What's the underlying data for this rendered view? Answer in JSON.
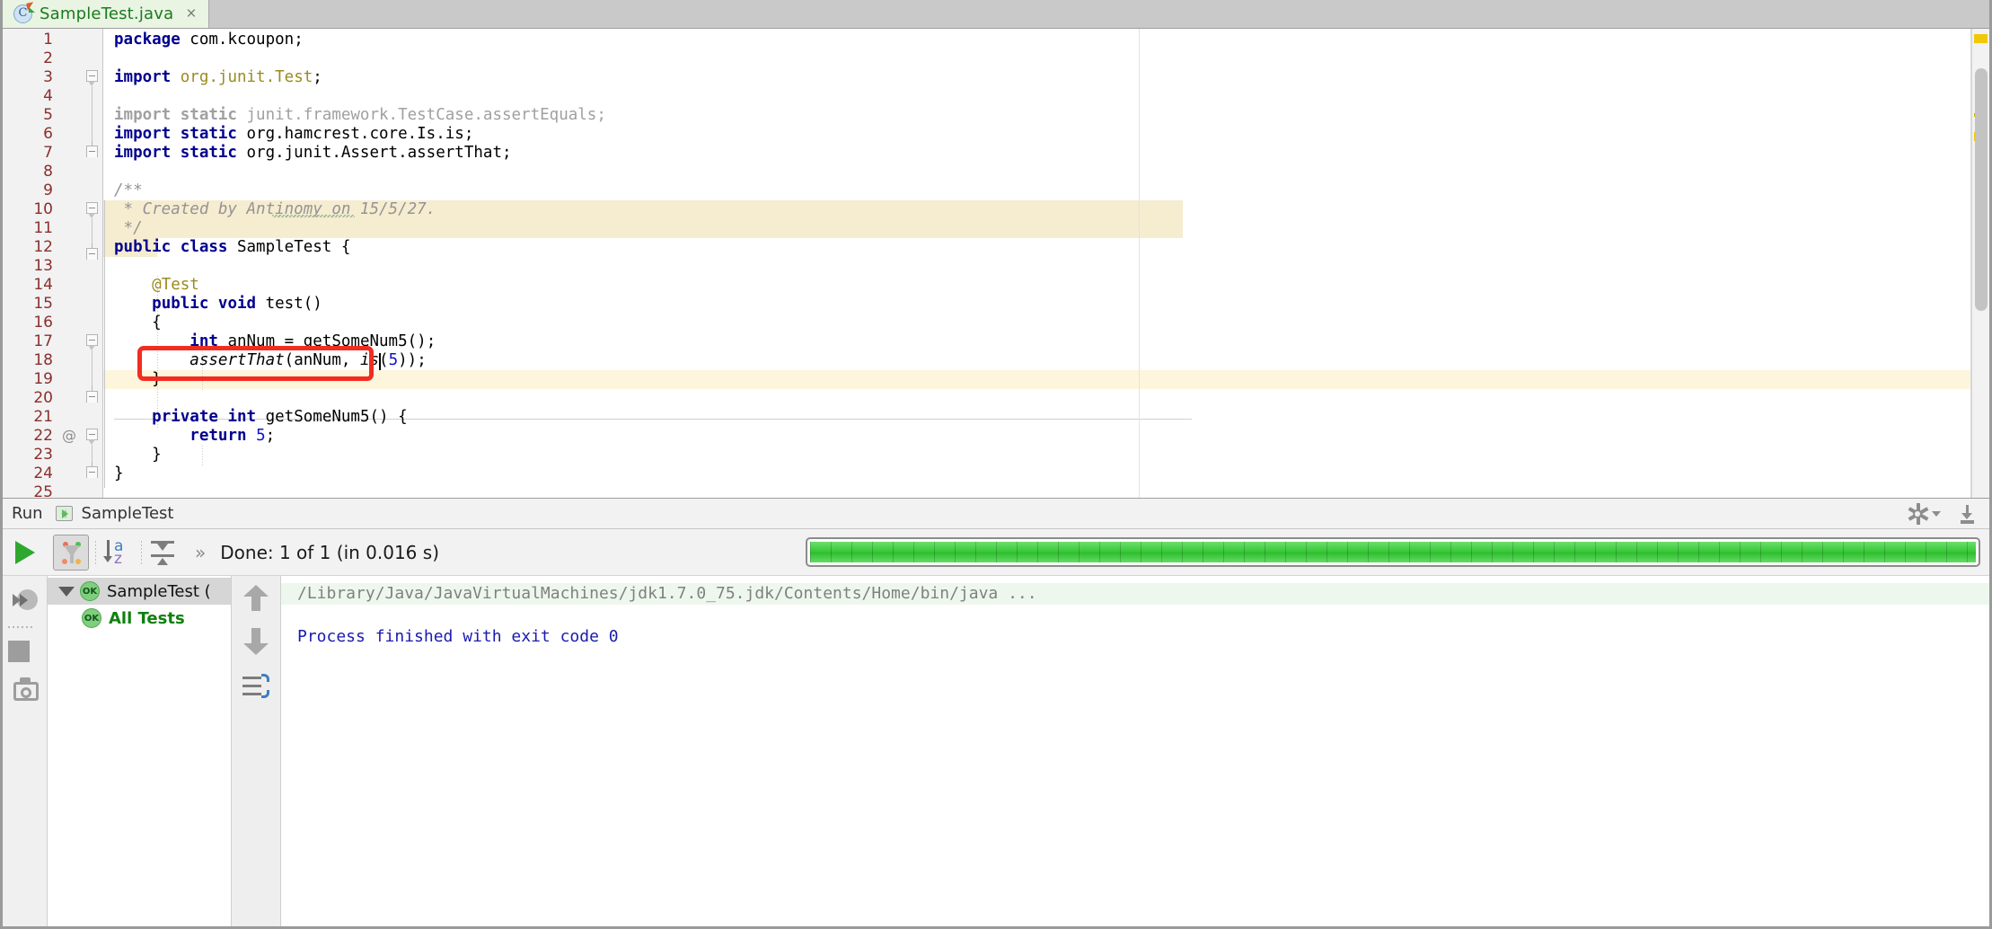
{
  "window": {
    "editor_tab": {
      "filename": "SampleTest.java",
      "icon": "java-class-icon",
      "close_label": "×"
    }
  },
  "editor": {
    "lines": [
      {
        "n": "1",
        "at": "",
        "text": "package com.kcoupon;"
      },
      {
        "n": "2",
        "at": "",
        "text": ""
      },
      {
        "n": "3",
        "at": "",
        "text": "import org.junit.Test;"
      },
      {
        "n": "4",
        "at": "",
        "text": ""
      },
      {
        "n": "5",
        "at": "",
        "text": "import static junit.framework.TestCase.assertEquals;"
      },
      {
        "n": "6",
        "at": "",
        "text": "import static org.hamcrest.core.Is.is;"
      },
      {
        "n": "7",
        "at": "",
        "text": "import static org.junit.Assert.assertThat;"
      },
      {
        "n": "8",
        "at": "",
        "text": ""
      },
      {
        "n": "9",
        "at": "",
        "text": "/**"
      },
      {
        "n": "10",
        "at": "",
        "text": " * Created by Antinomy on 15/5/27."
      },
      {
        "n": "11",
        "at": "",
        "text": " */"
      },
      {
        "n": "12",
        "at": "",
        "text": "public class SampleTest {"
      },
      {
        "n": "13",
        "at": "",
        "text": ""
      },
      {
        "n": "14",
        "at": "",
        "text": "    @Test"
      },
      {
        "n": "15",
        "at": "",
        "text": "    public void test()"
      },
      {
        "n": "16",
        "at": "",
        "text": "    {"
      },
      {
        "n": "17",
        "at": "",
        "text": "        int anNum = getSomeNum5();"
      },
      {
        "n": "18",
        "at": "",
        "text": "        assertThat(anNum, is(5));"
      },
      {
        "n": "19",
        "at": "",
        "text": "    }"
      },
      {
        "n": "20",
        "at": "",
        "text": ""
      },
      {
        "n": "21",
        "at": "@",
        "text": "    private int getSomeNum5() {"
      },
      {
        "n": "22",
        "at": "",
        "text": "        return 5;"
      },
      {
        "n": "23",
        "at": "",
        "text": "    }"
      },
      {
        "n": "24",
        "at": "",
        "text": "}"
      },
      {
        "n": "25",
        "at": "",
        "text": ""
      }
    ],
    "annotation": {
      "type": "red-rectangle-highlight",
      "target_line": "18",
      "color": "#f22d20"
    },
    "caret_line": "18",
    "spellcheck_word": "Antinomy"
  },
  "run_window": {
    "header": {
      "title": "Run",
      "config_icon": "run-configuration-icon",
      "tab_label": "SampleTest",
      "settings_icon": "gear-icon",
      "hide_icon": "hide-window-icon"
    },
    "toolbar": {
      "rerun_icon": "run-play-icon",
      "filter_icon": "filter-passed-tests-icon",
      "sort_icon": "sort-alphabetically-icon",
      "expand_icon": "expand-collapse-icon",
      "overflow_label": "»",
      "status": "Done: 1 of 1 (in 0.016 s)",
      "progress_percent": 100,
      "progress_color": "#35c935"
    },
    "left_strip": {
      "rerun_failed_icon": "rerun-failed-tests-icon",
      "stop_icon": "stop-process-icon",
      "export_icon": "export-screenshot-icon"
    },
    "test_tree": {
      "rows": [
        {
          "label": "SampleTest (",
          "status": "OK",
          "expanded": true,
          "selected": true,
          "bold": false
        },
        {
          "label": "All Tests",
          "status": "OK",
          "expanded": false,
          "selected": false,
          "bold": true
        }
      ]
    },
    "nav_strip": {
      "up_icon": "previous-failed-test-icon",
      "down_icon": "next-failed-test-icon",
      "wrap_icon": "toggle-soft-wrap-icon"
    },
    "console": {
      "lines": [
        {
          "text": "/Library/Java/JavaVirtualMachines/jdk1.7.0_75.jdk/Contents/Home/bin/java ...",
          "style": "path"
        },
        {
          "text": "Process finished with exit code 0",
          "style": "exit"
        }
      ]
    }
  }
}
